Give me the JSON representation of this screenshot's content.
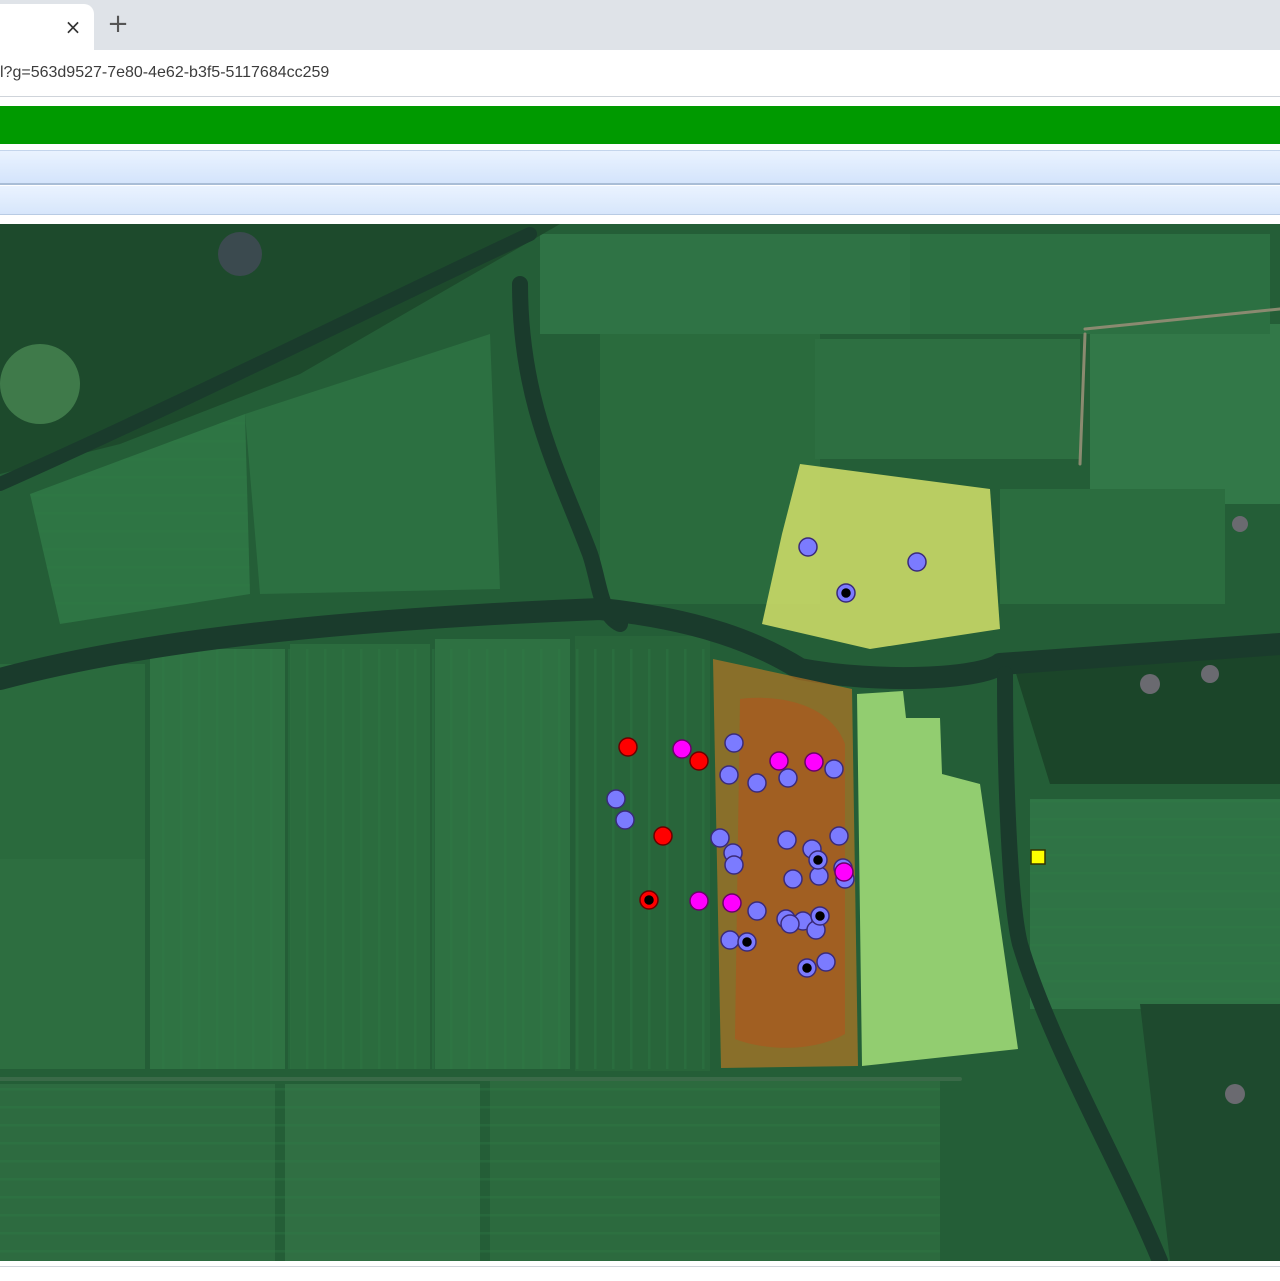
{
  "browser": {
    "tab": {
      "close_glyph": "×"
    },
    "new_tab_glyph": "+",
    "url": "l?g=563d9527-7e80-4e62-b3f5-5117684cc259"
  },
  "colors": {
    "header_green": "#009a00",
    "toolbar_blue": "#dce9fb",
    "marker_blue": "#7b7bff",
    "marker_magenta": "#ff00ff",
    "marker_red": "#ff0000",
    "marker_yellow": "#ffff00",
    "field_yellow": "#d4e06a",
    "field_orange": "#c87a22",
    "field_lightgreen": "#a6e07a"
  },
  "map": {
    "type": "satellite",
    "overlays": [
      "field-yellow",
      "field-orange",
      "field-lightgreen"
    ],
    "marker_counts": {
      "blue": 31,
      "magenta": 6,
      "red": 4,
      "yellow": 1
    }
  }
}
